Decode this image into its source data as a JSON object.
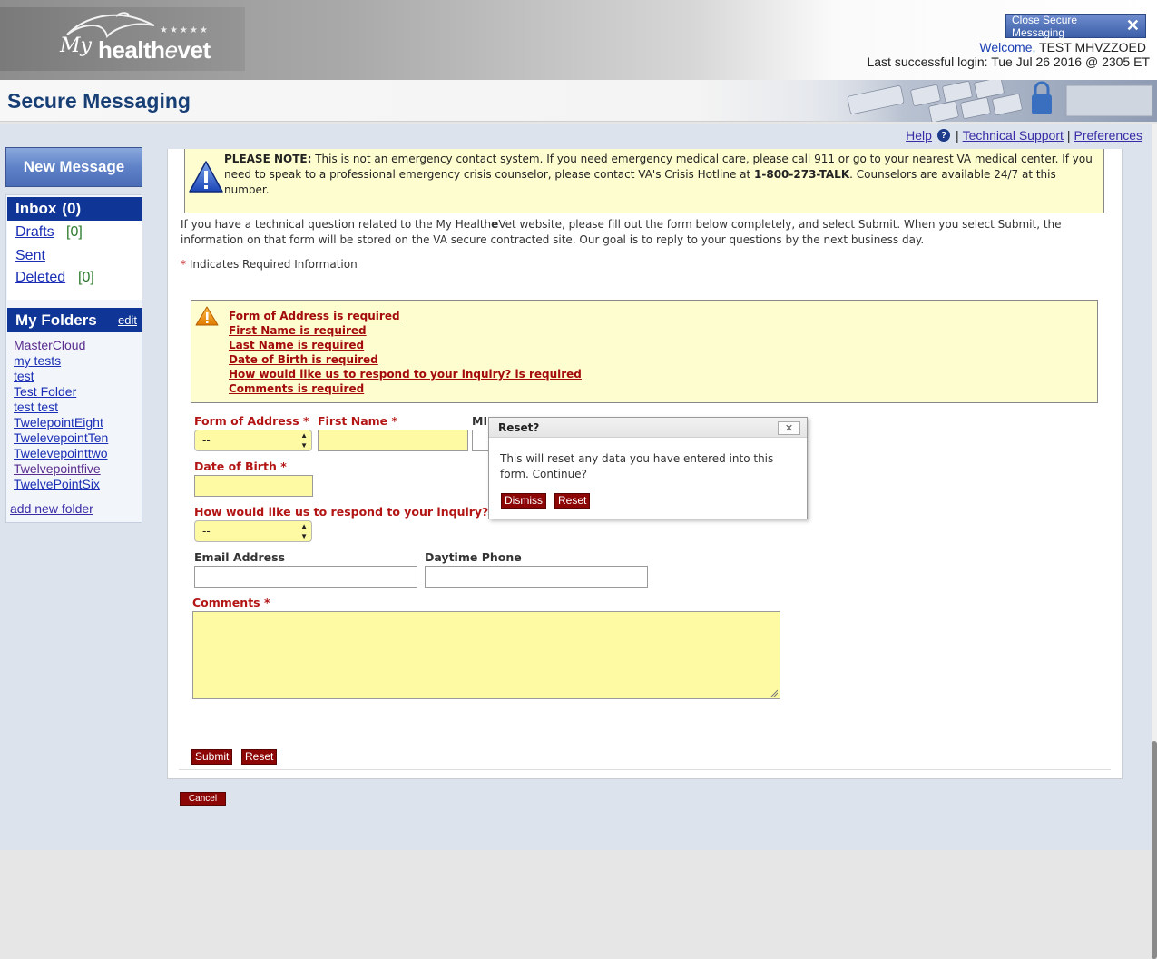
{
  "header": {
    "logo_my": "My",
    "logo_health": "health",
    "logo_e": "e",
    "logo_vet": "vet",
    "logo_stars": "★★★★★",
    "close_button_label": "Close Secure Messaging",
    "welcome_word": "Welcome,",
    "user_name": "TEST MHVZZOED",
    "last_login": "Last successful login: Tue Jul 26 2016 @ 2305 ET"
  },
  "page_title": "Secure Messaging",
  "util_links": {
    "help": "Help",
    "sep1": "|",
    "technical_support": "Technical Support",
    "sep2": "|",
    "preferences": "Preferences"
  },
  "sidebar": {
    "new_message": "New Message",
    "inbox_label": "Inbox",
    "inbox_count": "(0)",
    "drafts_label": "Drafts",
    "drafts_count": "[0]",
    "sent_label": "Sent",
    "deleted_label": "Deleted",
    "deleted_count": "[0]",
    "folders_heading": "My Folders",
    "folders_edit": "edit",
    "folders": [
      "MasterCloud",
      "my tests",
      "test",
      "Test Folder",
      "test test",
      "TwelepointEight",
      "TwelevepointTen",
      "Twelevepointtwo",
      "Twelvepointfive",
      "TwelvePointSix"
    ],
    "add_folder": "add new folder"
  },
  "note": {
    "bold": "PLEASE NOTE:",
    "part1": " This is not an emergency contact system. If you need emergency medical care, please call 911 or go to your nearest VA medical center. If you need to speak to a professional emergency crisis counselor, please contact VA's Crisis Hotline at ",
    "hotline": "1-800-273-TALK",
    "part2": ". Counselors are available 24/7 at this number."
  },
  "intro": {
    "part1": "If you have a technical question related to the My Health",
    "e": "e",
    "part2": "Vet website, please fill out the form below completely, and select Submit. When you select Submit, the information on that form will be stored on the VA secure contracted site. Our goal is to reply to your questions by the next business day."
  },
  "required_note": {
    "star": "*",
    "text": " Indicates Required Information"
  },
  "errors": [
    "Form of Address is required",
    "First Name is required",
    "Last Name is required",
    "Date of Birth is required",
    "How would like us to respond to your inquiry? is required",
    "Comments is required"
  ],
  "form": {
    "form_of_address_label": "Form of Address *",
    "form_of_address_value": "--",
    "first_name_label": "First Name *",
    "mi_label": "MI",
    "dob_label": "Date of Birth *",
    "respond_label": "How would like us to respond to your inquiry? *",
    "respond_value": "--",
    "email_label": "Email Address",
    "phone_label": "Daytime Phone",
    "comments_label": "Comments *",
    "submit": "Submit",
    "reset": "Reset",
    "cancel": "Cancel"
  },
  "modal": {
    "title": "Reset?",
    "close": "✕",
    "body": "This will reset any data you have entered into this form. Continue?",
    "dismiss": "Dismiss",
    "reset": "Reset"
  },
  "colors": {
    "brand_blue": "#0f3596",
    "title_blue": "#183f75",
    "error_red": "#a40c0c",
    "button_dark_red": "#8d0606",
    "field_yellow": "#fef9a3"
  }
}
